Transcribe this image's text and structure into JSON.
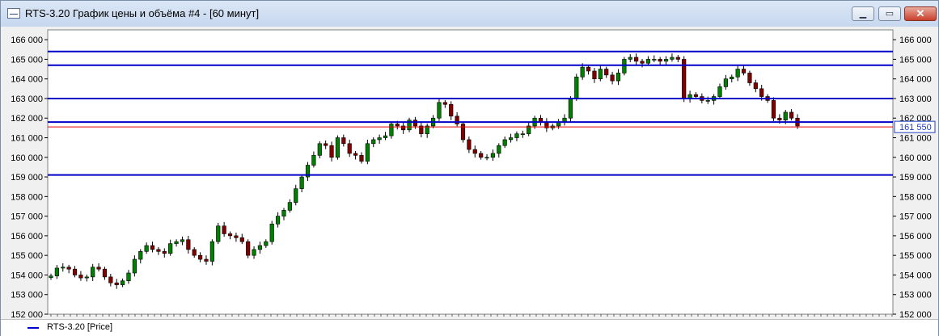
{
  "window": {
    "title": "RTS-3.20 График цены и объёма #4 - [60 минут]",
    "buttons": {
      "minimize": "▁",
      "maximize": "▭",
      "close": "✕"
    }
  },
  "legend": {
    "label": "RTS-3.20 [Price]",
    "color": "#0000c8"
  },
  "chart_data": {
    "type": "candlestick",
    "ylim": [
      152000,
      166500
    ],
    "yticks": [
      152000,
      153000,
      154000,
      155000,
      156000,
      157000,
      158000,
      159000,
      160000,
      161000,
      162000,
      163000,
      164000,
      165000,
      166000
    ],
    "ytick_labels": [
      "152 000",
      "153 000",
      "154 000",
      "155 000",
      "156 000",
      "157 000",
      "158 000",
      "159 000",
      "160 000",
      "161 000",
      "162 000",
      "163 000",
      "164 000",
      "165 000",
      "166 000"
    ],
    "up_color": "#008000",
    "down_color": "#800000",
    "levels_blue": [
      165400,
      164700,
      163000,
      161800,
      159100
    ],
    "level_red": 161550,
    "last_price": 161550,
    "last_price_label": "161 550",
    "closes": [
      153950,
      154350,
      154400,
      154300,
      154000,
      153850,
      153900,
      154400,
      154300,
      153900,
      153600,
      153500,
      153700,
      154100,
      154800,
      155200,
      155500,
      155300,
      155200,
      155100,
      155600,
      155700,
      155800,
      155300,
      155000,
      154800,
      154700,
      155700,
      156500,
      156100,
      156000,
      155900,
      155700,
      155000,
      155300,
      155500,
      155700,
      156600,
      157000,
      157300,
      157700,
      158400,
      159000,
      159600,
      160100,
      160700,
      160600,
      160000,
      161000,
      160700,
      160200,
      160100,
      159800,
      160700,
      160900,
      161000,
      161100,
      161700,
      161600,
      161400,
      161900,
      161600,
      161200,
      161600,
      162000,
      162800,
      162700,
      162100,
      161700,
      160900,
      160400,
      160200,
      160000,
      160000,
      160200,
      160600,
      160900,
      161000,
      161200,
      161200,
      161600,
      162000,
      161800,
      161500,
      161600,
      161800,
      162000,
      163000,
      164100,
      164600,
      164400,
      164000,
      164500,
      164200,
      163900,
      164300,
      165000,
      165100,
      164900,
      164800,
      165000,
      165000,
      164900,
      165000,
      165100,
      165000,
      163000,
      163200,
      163100,
      162900,
      162900,
      163100,
      163600,
      164000,
      164100,
      164500,
      164300,
      163800,
      163500,
      163100,
      162900,
      162000,
      161900,
      162300,
      162000,
      161600
    ]
  }
}
